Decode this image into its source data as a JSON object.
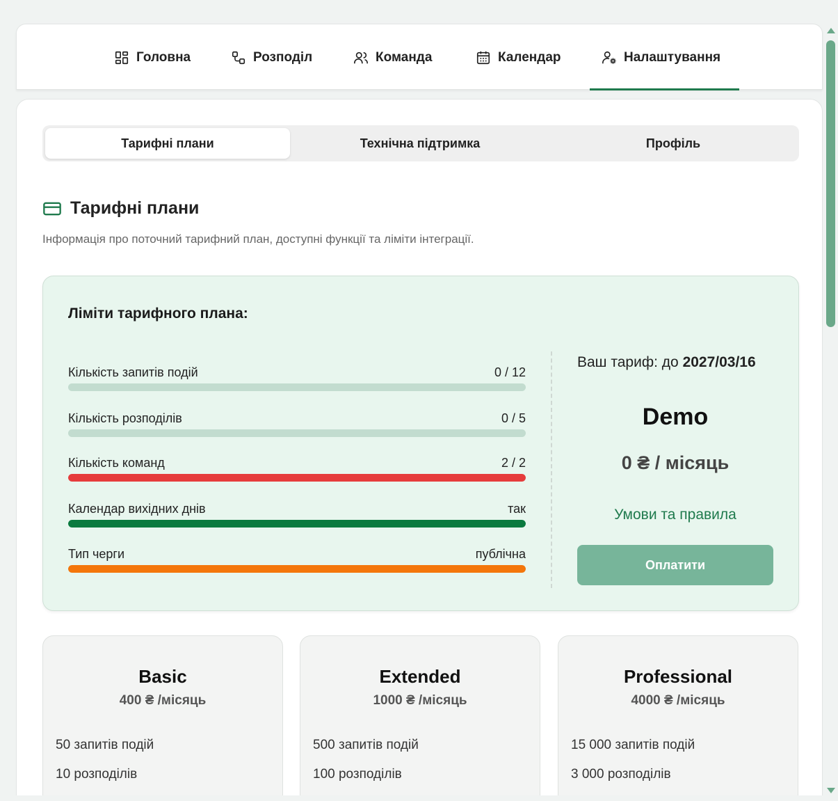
{
  "nav": {
    "items": [
      {
        "label": "Головна",
        "icon": "grid-icon"
      },
      {
        "label": "Розподіл",
        "icon": "distribution-icon"
      },
      {
        "label": "Команда",
        "icon": "users-icon"
      },
      {
        "label": "Календар",
        "icon": "calendar-icon"
      },
      {
        "label": "Налаштування",
        "icon": "user-settings-icon"
      }
    ],
    "active_index": 4
  },
  "tabs": {
    "items": [
      {
        "label": "Тарифні плани"
      },
      {
        "label": "Технічна підтримка"
      },
      {
        "label": "Профіль"
      }
    ],
    "active_index": 0
  },
  "section": {
    "title": "Тарифні плани",
    "icon": "credit-card-icon",
    "description": "Інформація про поточний тарифний план, доступні функції та ліміти інтеграції."
  },
  "limits": {
    "title": "Ліміти тарифного плана:",
    "rows": [
      {
        "label": "Кількість запитів подій",
        "value": "0 / 12",
        "fill": 0,
        "color": "#c2dccf"
      },
      {
        "label": "Кількість розподілів",
        "value": "0 / 5",
        "fill": 0,
        "color": "#c2dccf"
      },
      {
        "label": "Кількість команд",
        "value": "2 / 2",
        "fill": 1,
        "color": "#e63c3c"
      },
      {
        "label": "Календар вихідних днів",
        "value": "так",
        "fill": 1,
        "color": "#0a7a3f"
      },
      {
        "label": "Тип черги",
        "value": "публічна",
        "fill": 1,
        "color": "#f4760b"
      }
    ]
  },
  "current_plan": {
    "until_prefix": "Ваш тариф: до ",
    "until_date": "2027/03/16",
    "name": "Demo",
    "price": "0 ₴ / місяць",
    "terms_link": "Умови та правила",
    "pay_button": "Оплатити"
  },
  "plans": [
    {
      "name": "Basic",
      "price": "400 ₴ /місяць",
      "features": [
        "50 запитів подій",
        "10 розподілів"
      ]
    },
    {
      "name": "Extended",
      "price": "1000 ₴ /місяць",
      "features": [
        "500 запитів подій",
        "100 розподілів"
      ]
    },
    {
      "name": "Professional",
      "price": "4000 ₴ /місяць",
      "features": [
        "15 000 запитів подій",
        "3 000 розподілів"
      ]
    }
  ],
  "colors": {
    "accent": "#1f7a4d",
    "limits_bg": "#e8f6ee",
    "pay_button": "#77b59a"
  }
}
